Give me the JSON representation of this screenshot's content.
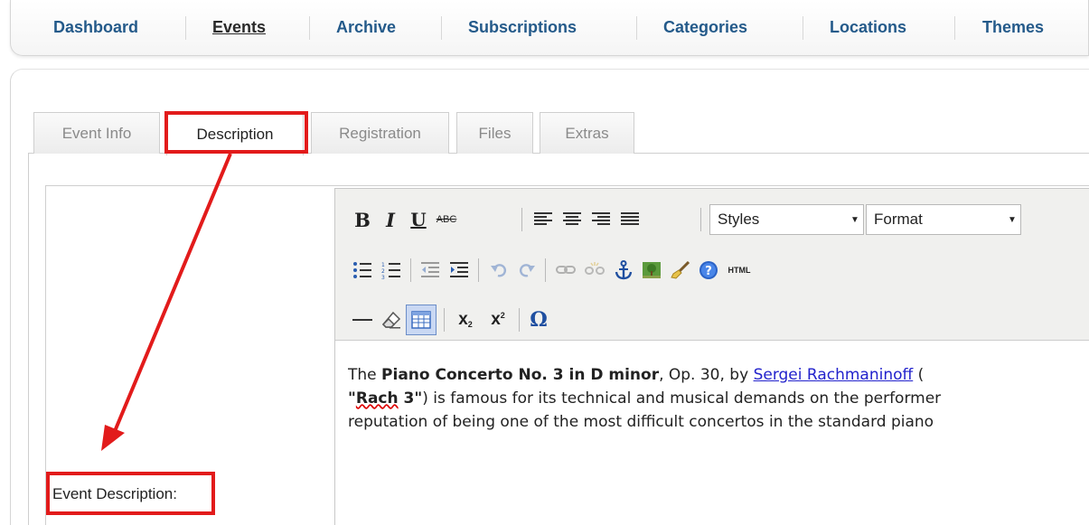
{
  "nav": {
    "items": [
      "Dashboard",
      "Events",
      "Archive",
      "Subscriptions",
      "Categories",
      "Locations",
      "Themes"
    ],
    "active": "Events"
  },
  "tabs": [
    "Event Info",
    "Description",
    "Registration",
    "Files",
    "Extras"
  ],
  "active_tab": "Description",
  "form": {
    "description_label": "Event Description:"
  },
  "editor": {
    "toolbar": {
      "bold": "B",
      "italic": "I",
      "underline": "U",
      "strikethrough": "ABC",
      "styles_select": "Styles",
      "format_select": "Format",
      "html_button": "HTML",
      "omega": "Ω"
    },
    "content": {
      "p1_pre": "The ",
      "p1_bold": "Piano Concerto No. 3 in D minor",
      "p1_mid": ", Op. 30, by ",
      "p1_link": "Sergei Rachmaninoff",
      "p1_post": " (",
      "p2_bold_q1": "\"",
      "p2_spell": "Rach",
      "p2_bold_rest": " 3\"",
      "p2_post": ") is famous for its technical and musical demands on the performer",
      "p3": "reputation of being one of the most difficult concertos in the standard piano"
    }
  },
  "colors": {
    "annotation": "#e21b1b",
    "nav_link": "#245a8a",
    "link": "#2222cc"
  }
}
